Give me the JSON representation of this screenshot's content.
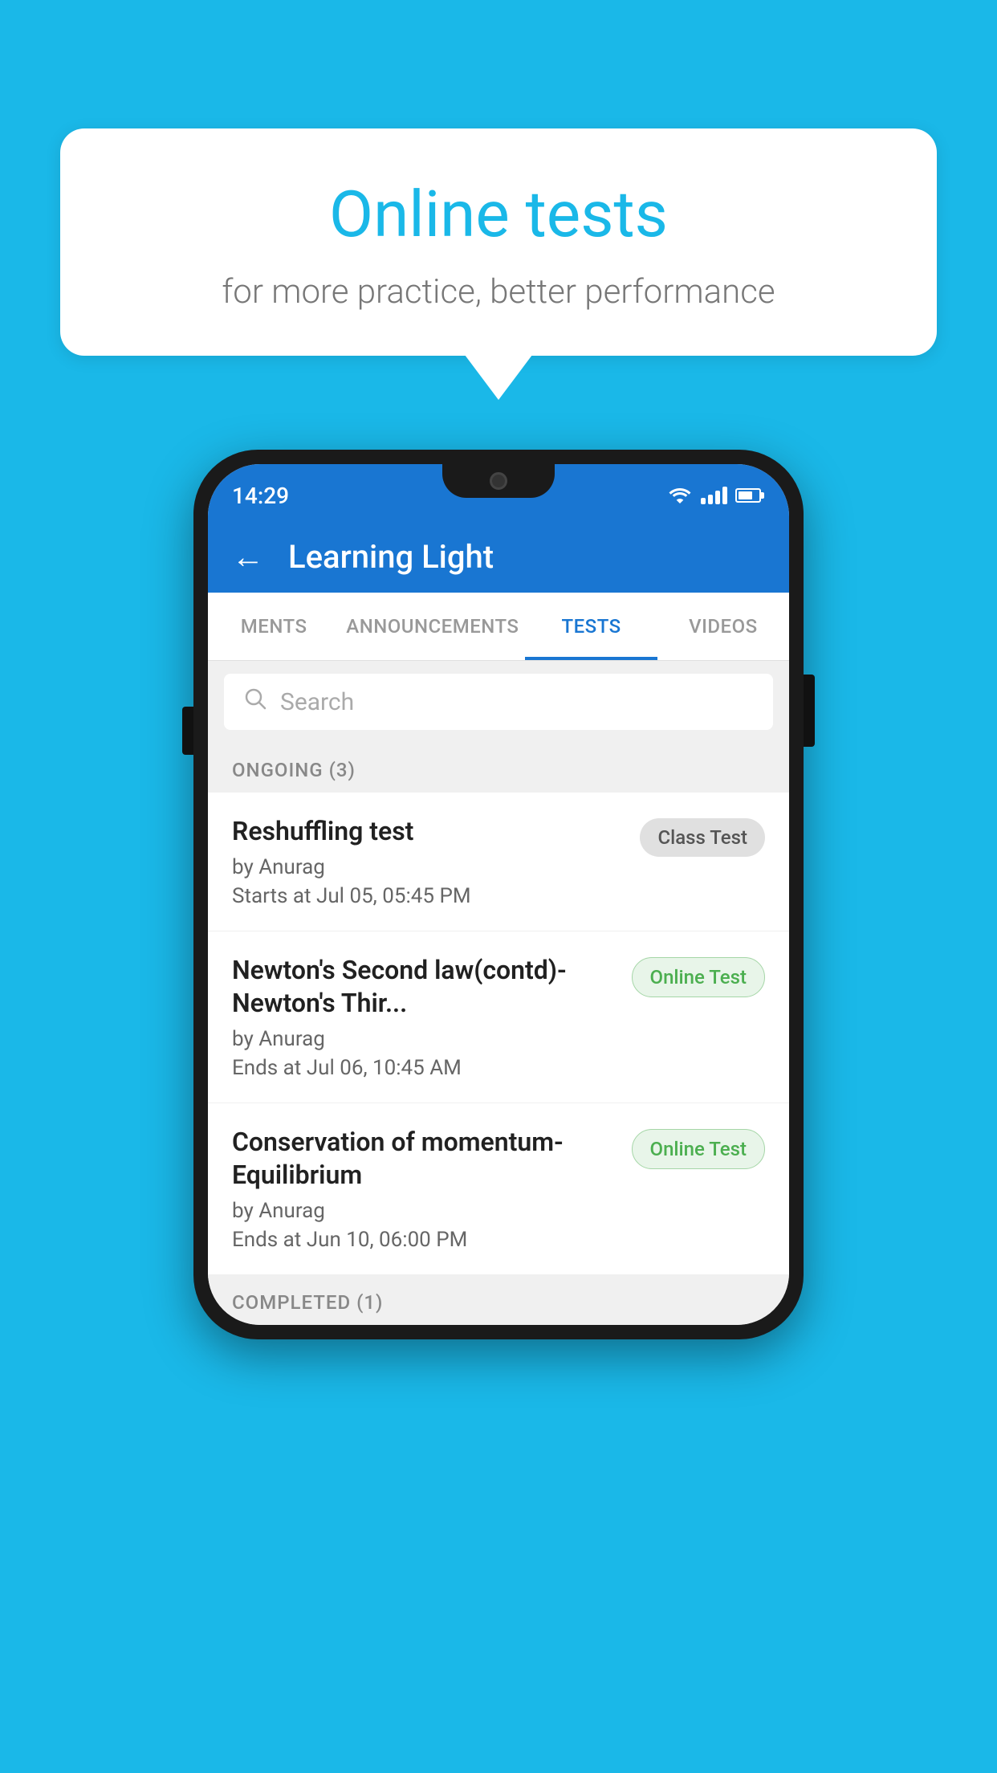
{
  "background_color": "#1ab8e8",
  "speech_bubble": {
    "title": "Online tests",
    "subtitle": "for more practice, better performance"
  },
  "phone": {
    "status_bar": {
      "time": "14:29"
    },
    "app_header": {
      "title": "Learning Light",
      "back_label": "←"
    },
    "tabs": [
      {
        "label": "MENTS",
        "active": false
      },
      {
        "label": "ANNOUNCEMENTS",
        "active": false
      },
      {
        "label": "TESTS",
        "active": true
      },
      {
        "label": "VIDEOS",
        "active": false
      }
    ],
    "search": {
      "placeholder": "Search"
    },
    "ongoing_section": {
      "label": "ONGOING (3)",
      "tests": [
        {
          "name": "Reshuffling test",
          "author": "by Anurag",
          "date": "Starts at  Jul 05, 05:45 PM",
          "badge": "Class Test",
          "badge_type": "class"
        },
        {
          "name": "Newton's Second law(contd)-Newton's Thir...",
          "author": "by Anurag",
          "date": "Ends at  Jul 06, 10:45 AM",
          "badge": "Online Test",
          "badge_type": "online"
        },
        {
          "name": "Conservation of momentum-Equilibrium",
          "author": "by Anurag",
          "date": "Ends at  Jun 10, 06:00 PM",
          "badge": "Online Test",
          "badge_type": "online"
        }
      ]
    },
    "completed_section": {
      "label": "COMPLETED (1)"
    }
  }
}
